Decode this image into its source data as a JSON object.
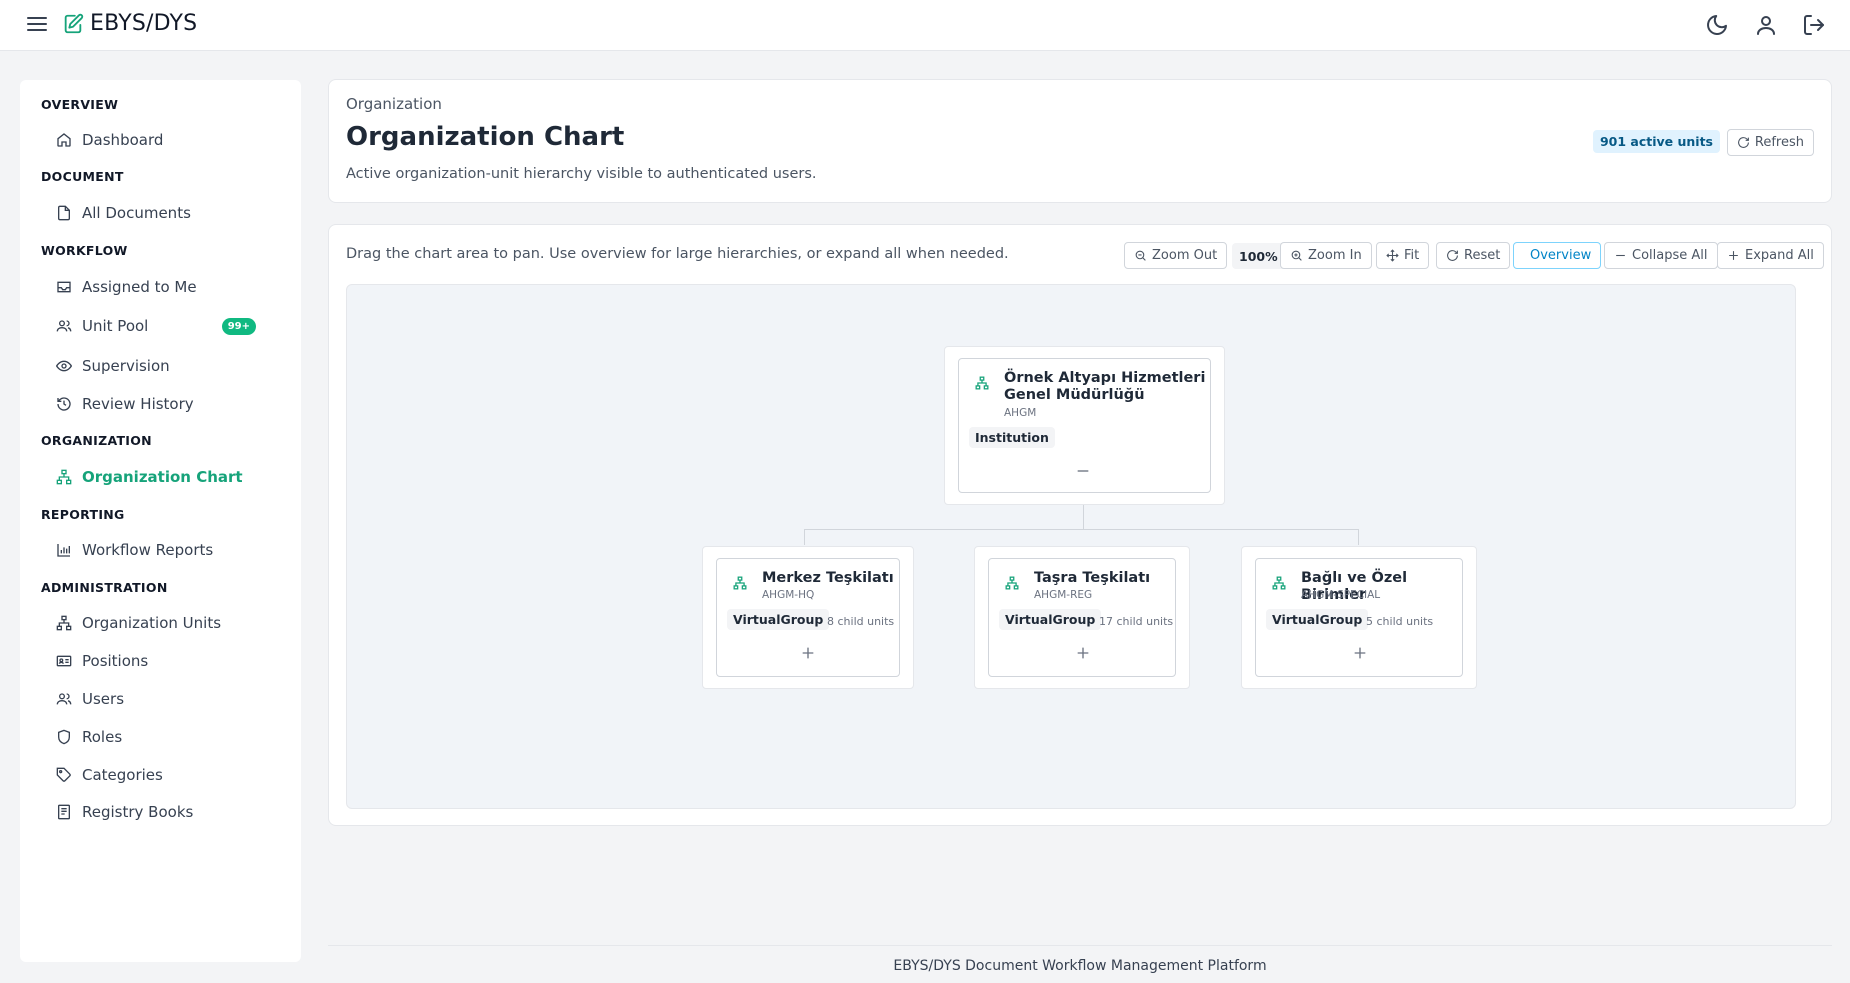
{
  "app": {
    "title": "EBYS/DYS"
  },
  "sidebar": {
    "sections": [
      {
        "label": "OVERVIEW",
        "items": [
          {
            "label": "Dashboard",
            "icon": "home-icon"
          }
        ]
      },
      {
        "label": "DOCUMENT",
        "items": [
          {
            "label": "All Documents",
            "icon": "file-icon"
          }
        ]
      },
      {
        "label": "WORKFLOW",
        "items": [
          {
            "label": "Assigned to Me",
            "icon": "inbox-icon"
          },
          {
            "label": "Unit Pool",
            "icon": "users-icon",
            "badge": "99+"
          },
          {
            "label": "Supervision",
            "icon": "eye-icon"
          },
          {
            "label": "Review History",
            "icon": "history-icon"
          }
        ]
      },
      {
        "label": "ORGANIZATION",
        "items": [
          {
            "label": "Organization Chart",
            "icon": "org-chart-icon",
            "active": true
          }
        ]
      },
      {
        "label": "REPORTING",
        "items": [
          {
            "label": "Workflow Reports",
            "icon": "bar-chart-icon"
          }
        ]
      },
      {
        "label": "ADMINISTRATION",
        "items": [
          {
            "label": "Organization Units",
            "icon": "org-chart-icon"
          },
          {
            "label": "Positions",
            "icon": "id-card-icon"
          },
          {
            "label": "Users",
            "icon": "users-icon"
          },
          {
            "label": "Roles",
            "icon": "shield-icon"
          },
          {
            "label": "Categories",
            "icon": "tag-icon"
          },
          {
            "label": "Registry Books",
            "icon": "book-icon"
          }
        ]
      }
    ]
  },
  "header": {
    "breadcrumb": "Organization",
    "title": "Organization Chart",
    "subtitle": "Active organization-unit hierarchy visible to authenticated users.",
    "active_units": "901 active units",
    "refresh_label": "Refresh"
  },
  "toolbar": {
    "hint": "Drag the chart area to pan. Use overview for large hierarchies, or expand all when needed.",
    "zoom_out": "Zoom Out",
    "zoom_level": "100%",
    "zoom_in": "Zoom In",
    "fit": "Fit",
    "reset": "Reset",
    "overview": "Overview",
    "collapse_all": "Collapse All",
    "expand_all": "Expand All"
  },
  "chart": {
    "root": {
      "name_line1": "Örnek Altyapı Hizmetleri",
      "name_line2": "Genel Müdürlüğü",
      "code": "AHGM",
      "type": "Institution"
    },
    "children": [
      {
        "name": "Merkez Teşkilatı",
        "code": "AHGM-HQ",
        "type": "VirtualGroup",
        "child_units": "8 child units"
      },
      {
        "name": "Taşra Teşkilatı",
        "code": "AHGM-REG",
        "type": "VirtualGroup",
        "child_units": "17 child units"
      },
      {
        "name": "Bağlı ve Özel Birimler",
        "code": "AHGM-SPECIAL",
        "type": "VirtualGroup",
        "child_units": "5 child units"
      }
    ]
  },
  "footer": {
    "text": "EBYS/DYS Document Workflow Management Platform"
  },
  "colors": {
    "accent": "#16a37a",
    "badge": "#10b981",
    "info_bg": "#e0f2fe",
    "info_text": "#075985"
  }
}
